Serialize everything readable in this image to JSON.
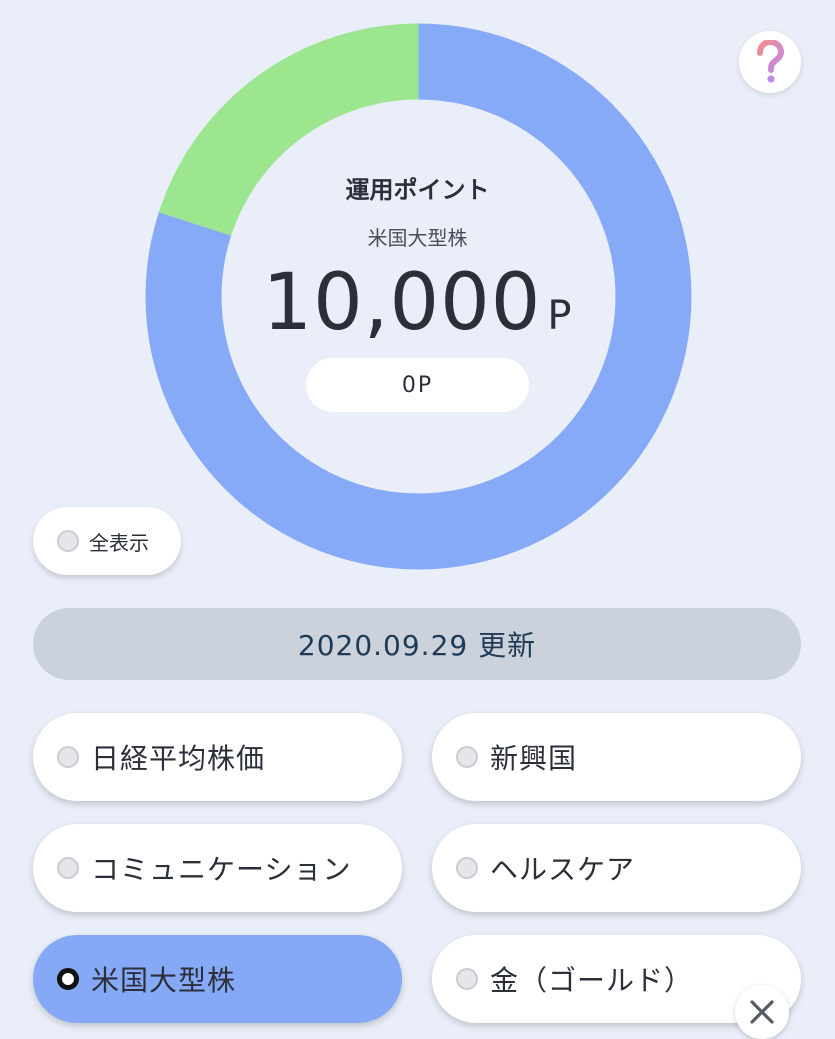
{
  "header": {
    "help_icon": "question-mark-icon",
    "help_colors": [
      "#f28c8c",
      "#c08ae8"
    ]
  },
  "chart_data": {
    "type": "pie",
    "style": "donut",
    "slices": [
      {
        "value": 80,
        "color": "#86aaf8"
      },
      {
        "value": 20,
        "color": "#9ce68f"
      }
    ]
  },
  "summary": {
    "title": "運用ポイント",
    "category": "米国大型株",
    "points_value": "10,000",
    "points_unit": "P",
    "sub_value": "0P"
  },
  "show_all": {
    "label": "全表示",
    "selected": false
  },
  "updated": {
    "label": "2020.09.29 更新"
  },
  "options": [
    {
      "label": "日経平均株価",
      "selected": false
    },
    {
      "label": "新興国",
      "selected": false
    },
    {
      "label": "コミュニケーション",
      "selected": false
    },
    {
      "label": "ヘルスケア",
      "selected": false
    },
    {
      "label": "米国大型株",
      "selected": true
    },
    {
      "label": "金（ゴールド）",
      "selected": false
    }
  ],
  "close": {
    "icon": "close-icon"
  }
}
